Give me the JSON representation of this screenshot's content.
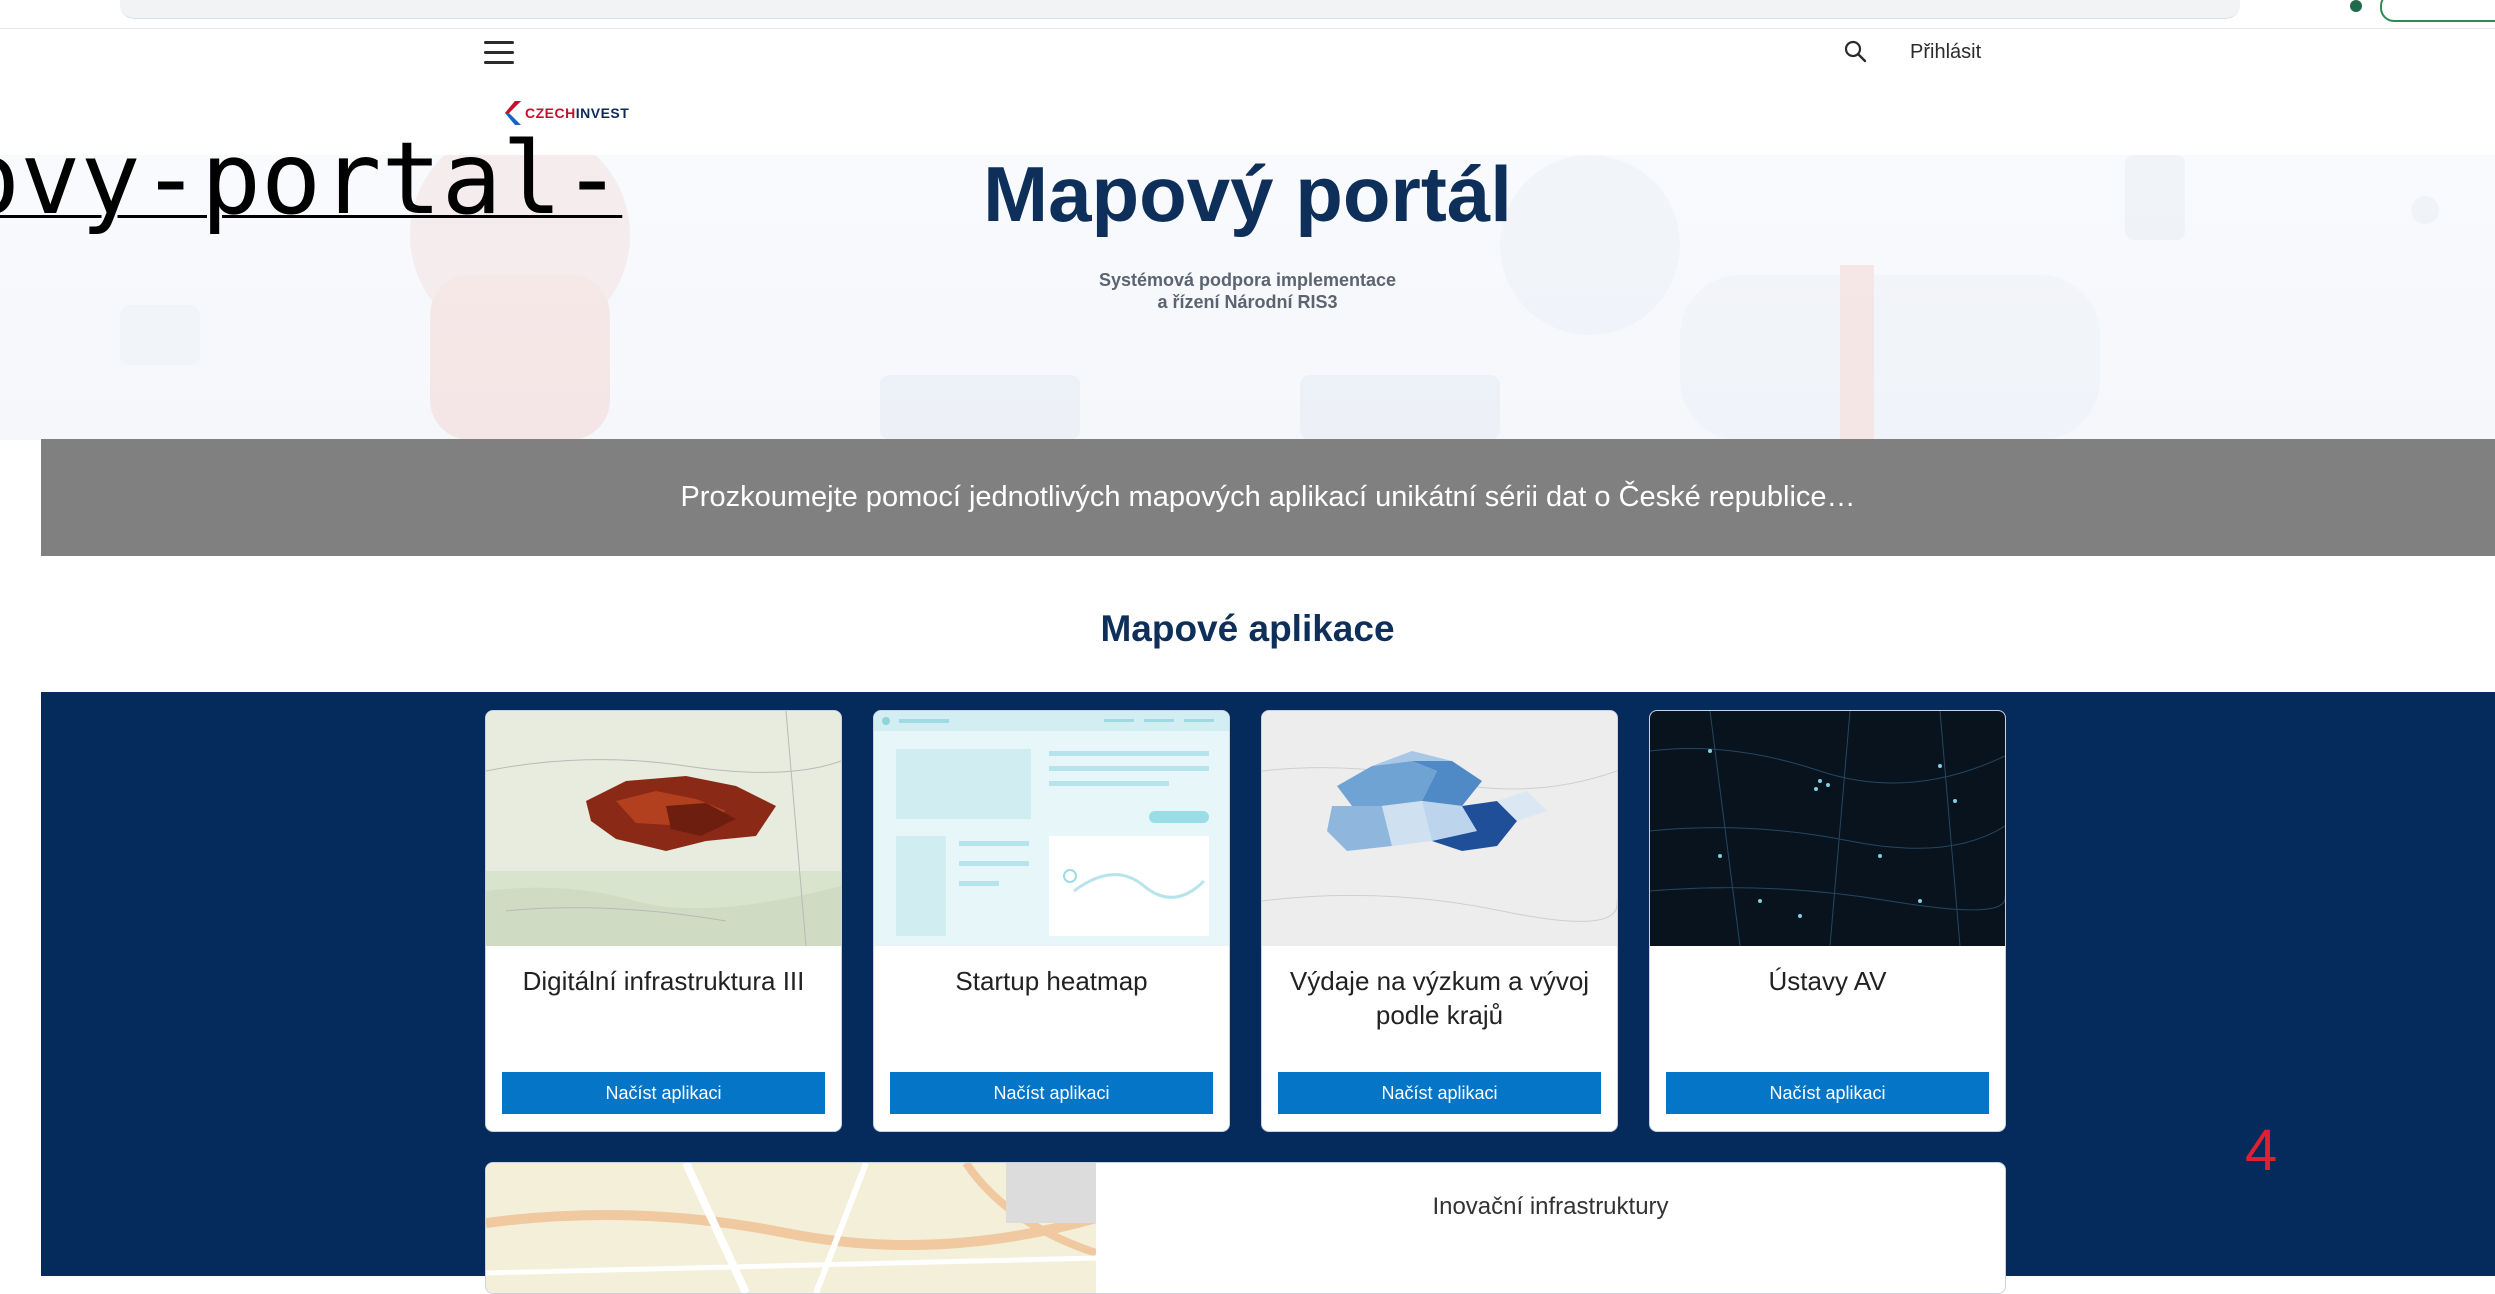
{
  "url_fragment": "ovy-portal-",
  "header": {
    "login_label": "Přihlásit",
    "menu_icon": "hamburger-menu-icon",
    "search_icon": "search-icon"
  },
  "logo": {
    "part1": "CZECH",
    "part2": "INVEST"
  },
  "hero": {
    "title": "Mapový portál",
    "subtitle_line1": "Systémová podpora implementace",
    "subtitle_line2": "a řízení Národní RIS3"
  },
  "banner": {
    "text": "Prozkoumejte pomocí jednotlivých mapových aplikací unikátní sérii dat o České republice…"
  },
  "apps_section": {
    "title": "Mapové aplikace",
    "cards": [
      {
        "title": "Digitální infrastruktura III",
        "button": "Načíst aplikaci"
      },
      {
        "title": "Startup heatmap",
        "button": "Načíst aplikaci"
      },
      {
        "title": "Výdaje na výzkum a vývoj podle krajů",
        "button": "Načíst aplikaci"
      },
      {
        "title": "Ústavy AV",
        "button": "Načíst aplikaci"
      }
    ],
    "wide_card": {
      "title": "Inovační infrastruktury"
    }
  },
  "annotation": "4",
  "colors": {
    "brand_navy": "#0e2f5a",
    "apps_background": "#052b5c",
    "button_blue": "#0575c8",
    "banner_grey": "#808080",
    "annotation_red": "#e0202e"
  }
}
